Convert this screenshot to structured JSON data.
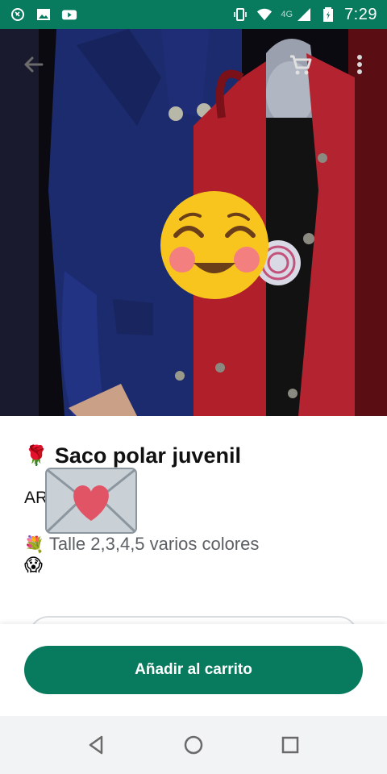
{
  "status_bar": {
    "time": "7:29",
    "network": "4G",
    "icons": [
      "whatsapp-business-icon",
      "image-icon",
      "youtube-icon",
      "vibrate-icon",
      "wifi-icon",
      "signal-icon",
      "battery-icon"
    ]
  },
  "toolbar": {
    "back_icon": "arrow-left-icon",
    "cart_icon": "cart-icon",
    "more_icon": "more-vert-icon"
  },
  "product": {
    "title_emoji": "🌹",
    "title": "Saco polar juvenil",
    "price": "AR",
    "description_emoji": "💐",
    "description": "Talle 2,3,4,5 varios colores",
    "emoji_line": "😱"
  },
  "cart": {
    "add_label": "Añadir al carrito"
  },
  "colors": {
    "brand": "#087a5e",
    "status_bar": "#087a5e"
  },
  "nav": {
    "back": "nav-back-icon",
    "home": "nav-home-icon",
    "recents": "nav-recents-icon"
  }
}
